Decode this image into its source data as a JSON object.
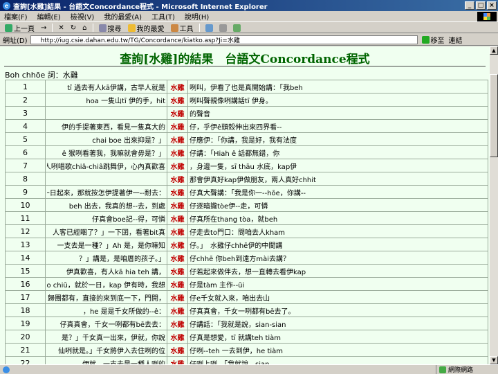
{
  "window": {
    "title": "查詢[水雞]結果 - 台語文Concordance程式 - Microsoft Internet Explorer",
    "min": "_",
    "max": "□",
    "close": "×"
  },
  "menu": [
    "檔案(F)",
    "編輯(E)",
    "檢視(V)",
    "我的最愛(A)",
    "工具(T)",
    "說明(H)"
  ],
  "toolbar": {
    "back": "上一頁",
    "forward": "→",
    "stop": "✕",
    "refresh": "↻",
    "home": "⌂",
    "search": "搜尋",
    "favorites": "我的最愛",
    "tools": "工具"
  },
  "address": {
    "label": "網址(D)",
    "value": "http://iug.csie.dahan.edu.tw/TG/Concordance/kiatko.asp?Ji=水雞",
    "go": "移至",
    "links": "連結"
  },
  "colors": {
    "title_green": "#006400",
    "keyword_red": "#c00000",
    "content_bg": "#f0fff0"
  },
  "page": {
    "title": "查詢[水雞]的結果　台語文Concordance程式",
    "keyword_line": "Boh chhōe 詞：水雞"
  },
  "results": [
    {
      "n": "1",
      "left": "tī 過去有人kā伊講，古早人就是",
      "kw": "水雞",
      "right": "咧叫，伊看了也是真開始講：「我beh"
    },
    {
      "n": "2",
      "left": "hoa 一隻山tī 伊的手，hit",
      "kw": "水雞",
      "right": "咧叫聲親像咧講話tī 伊身。"
    },
    {
      "n": "3",
      "left": "",
      "kw": "水雞",
      "right": "的聲音"
    },
    {
      "n": "4",
      "left": "伊的手提著東西，看見一隻真大的",
      "kw": "水雞",
      "right": "仔，乎伊ê頭殼伸出來四界看--"
    },
    {
      "n": "5",
      "left": "chai boe 出來抑是？」",
      "kw": "水雞",
      "right": "仔應伊：「你講，我是好，我有法度"
    },
    {
      "n": "6",
      "left": "ê 猴咧看著我，我嘛就會毋是？」",
      "kw": "水雞",
      "right": "仔講：「Hiah ê 話都無錯，你"
    },
    {
      "n": "7",
      "left": "兩人咧唱歌chiâ-chiâ跳舞伊，心內真歡喜",
      "kw": "水雞",
      "right": "，身邊一隻，sī thāu 水底，kap伊"
    },
    {
      "n": "8",
      "left": "",
      "kw": "水雞",
      "right": "那會伊真好kap伊做朋友，兩人真好chhit"
    },
    {
      "n": "9",
      "left": "伊有一日起來，那就按怎伊提著伊一--耐去：",
      "kw": "水雞",
      "right": "仔真大聲講：「我是你一--hōe，你講--"
    },
    {
      "n": "10",
      "left": "beh 出去，我真的想--去，到處",
      "kw": "水雞",
      "right": "仔逐暗攏tòe伊--走，可憐"
    },
    {
      "n": "11",
      "left": "仔真會boe記--得，可憐",
      "kw": "水雞",
      "right": "仔真所在thang tòa，就beh"
    },
    {
      "n": "12",
      "left": "人客已經睏了？」一下囝，看著bit真",
      "kw": "水雞",
      "right": "仔走去to門口：問咱去人kham"
    },
    {
      "n": "13",
      "left": "一支去是一種？」Ah 是，是你嘛知",
      "kw": "水雞",
      "right": "仔。」　水雞仔chhē伊的中間講"
    },
    {
      "n": "14",
      "left": "？」講是，是咱厝的孩子。」",
      "kw": "水雞",
      "right": "仔chhē 你beh到遠方mài去講？"
    },
    {
      "n": "15",
      "left": "伊真歡喜，有人kā hia teh 講，",
      "kw": "水雞",
      "right": "仔若起來做伴去，想一直轉去看伊kap"
    },
    {
      "n": "16",
      "left": "ko chiū，就於一日，kap 伊有時，我想",
      "kw": "水雞",
      "right": "仔是tàm 主作--ūi"
    },
    {
      "n": "17",
      "left": "說，歸團都有，直接的來到底一下，門開，",
      "kw": "水雞",
      "right": "仔e千女就入來，咱出去山"
    },
    {
      "n": "18",
      "left": "，he 是是千女所做的--ê：",
      "kw": "水雞",
      "right": "仔真真會，千女一咧都有bē去了。"
    },
    {
      "n": "19",
      "left": "仔真真會，千女一咧都有bē去去：",
      "kw": "水雞",
      "right": "仔講話：「我就是說，sian-sian"
    },
    {
      "n": "20",
      "left": "是？」千女真一出來，伊就，你說",
      "kw": "水雞",
      "right": "仔真是想愛，tī 就講teh tiàm"
    },
    {
      "n": "21",
      "left": "仙咧就是。」千女將伊入去住咧的位",
      "kw": "水雞",
      "right": "仔咧--teh 一去到伊，he tiàm"
    },
    {
      "n": "22",
      "left": "伊就，一支去是一種人咧的",
      "kw": "水雞",
      "right": "仔咧上咧，「我就說，sian"
    }
  ],
  "status": {
    "text": "",
    "zone": "網際網路"
  }
}
